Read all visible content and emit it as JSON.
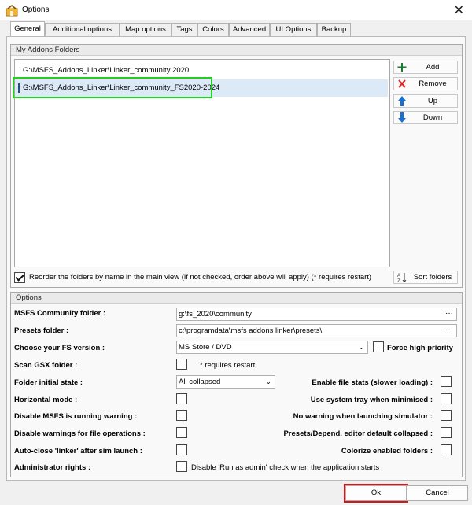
{
  "window": {
    "title": "Options",
    "app_icon": "options-app-icon",
    "close_glyph": "✕"
  },
  "tabs": [
    {
      "label": "General",
      "active": true
    },
    {
      "label": "Additional options"
    },
    {
      "label": "Map options"
    },
    {
      "label": "Tags"
    },
    {
      "label": "Colors"
    },
    {
      "label": "Advanced"
    },
    {
      "label": "UI Options"
    },
    {
      "label": "Backup"
    }
  ],
  "addons": {
    "group_title": "My Addons Folders",
    "folders": [
      "G:\\MSFS_Addons_Linker\\Linker_community 2020",
      "G:\\MSFS_Addons_Linker\\Linker_community_FS2020-2024"
    ],
    "selected_index": 1,
    "buttons": {
      "add": "Add",
      "remove": "Remove",
      "up": "Up",
      "down": "Down",
      "sort": "Sort folders"
    },
    "reorder_label": "Reorder the folders by name in the main view (if not checked, order above will apply) (* requires restart)",
    "reorder_checked": true
  },
  "options": {
    "group_title": "Options",
    "msfs_community_label": "MSFS Community folder :",
    "msfs_community_value": "g:\\fs_2020\\community",
    "presets_label": "Presets folder :",
    "presets_value": "c:\\programdata\\msfs addons linker\\presets\\",
    "browse_glyph": "···",
    "fs_version_label": "Choose your FS version :",
    "fs_version_value": "MS Store / DVD",
    "force_priority_label": "Force high priority",
    "scan_gsx_label": "Scan GSX folder :",
    "requires_restart_note": "* requires restart",
    "folder_state_label": "Folder initial state :",
    "folder_state_value": "All collapsed",
    "horizontal_mode_label": "Horizontal mode :",
    "disable_running_warning_label": "Disable MSFS is running warning :",
    "disable_file_warnings_label": "Disable warnings for file operations :",
    "auto_close_label": "Auto-close 'linker' after sim launch :",
    "admin_rights_label": "Administrator rights :",
    "admin_desc": "Disable 'Run as admin' check when the application starts",
    "file_stats_label": "Enable file stats (slower loading) :",
    "system_tray_label": "Use system tray when minimised :",
    "no_warning_launch_label": "No warning when launching simulator :",
    "presets_collapsed_label": "Presets/Depend. editor default collapsed :",
    "colorize_label": "Colorize enabled folders :"
  },
  "footer": {
    "ok": "Ok",
    "cancel": "Cancel"
  },
  "colors": {
    "highlight_green": "#22d020",
    "highlight_red": "#d01818",
    "selection": "#dceaf7"
  }
}
